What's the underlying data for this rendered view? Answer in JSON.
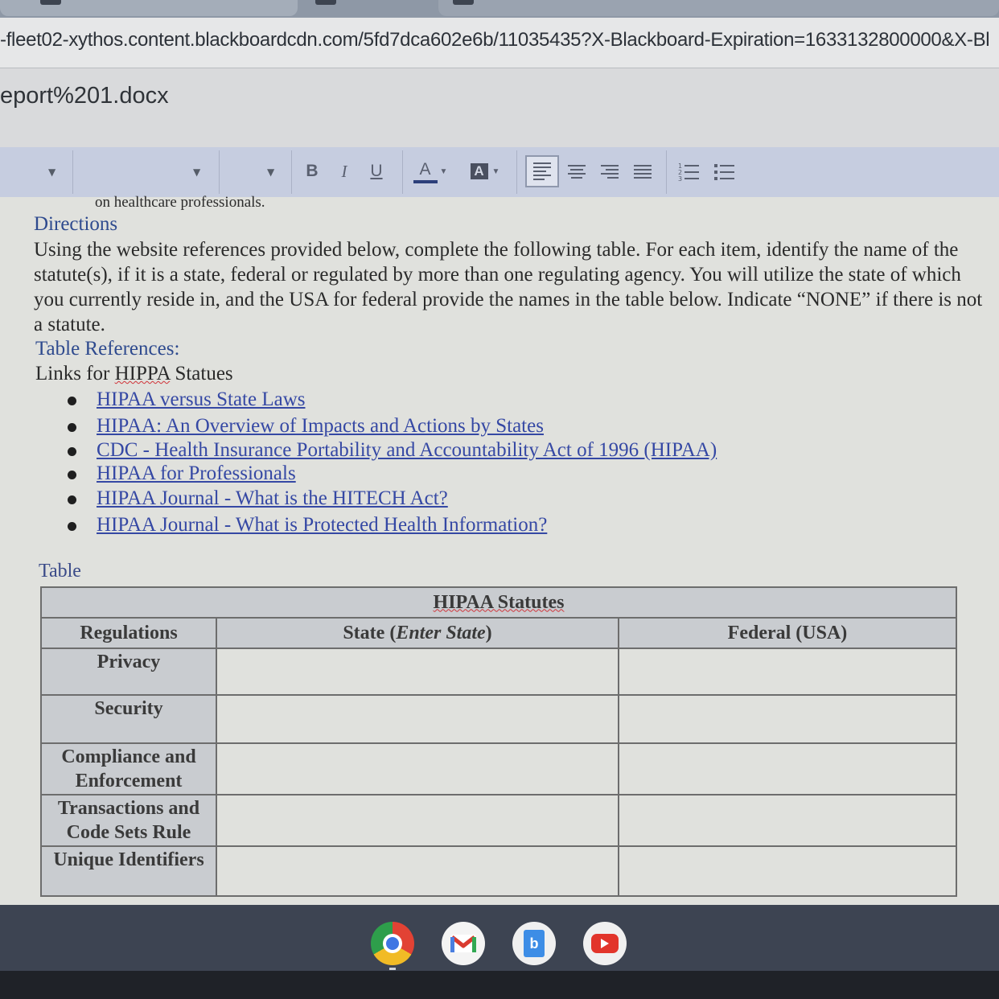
{
  "browser": {
    "url": "-fleet02-xythos.content.blackboardcdn.com/5fd7dca602e6b/11035435?X-Blackboard-Expiration=1633132800000&X-Bl"
  },
  "document": {
    "filename": "eport%201.docx"
  },
  "toolbar": {
    "bold": "B",
    "italic": "I",
    "underline": "U",
    "font_color": "A",
    "highlight": "A",
    "align_left_icon": "align-left-icon",
    "align_center_icon": "align-center-icon",
    "align_right_icon": "align-right-icon",
    "justify_icon": "justify-icon",
    "numbered_list_icon": "numbered-list-icon",
    "bulleted_list_icon": "bulleted-list-icon"
  },
  "content": {
    "cut_line": "on healthcare professionals.",
    "directions_heading": "Directions",
    "directions_text": "Using the website references provided below, complete the following table.  For each item, identify the name of the statute(s), if it is a state, federal or regulated by more than one regulating agency.  You will utilize the state of which you currently reside in, and the USA for federal provide the names in the table below. Indicate “NONE” if there is not a statute.",
    "references_heading": "Table References:",
    "links_intro_prefix": "Links for ",
    "links_intro_word": "HIPPA",
    "links_intro_suffix": " Statues",
    "links": [
      "HIPAA versus State Laws",
      "HIPAA: An Overview of Impacts and Actions by States",
      "CDC - Health Insurance Portability and Accountability Act of 1996 (HIPAA)",
      "HIPAA for Professionals",
      "HIPAA Journal - What is the HITECH Act?",
      "HIPAA Journal - What is Protected Health Information?"
    ],
    "table_caption": "Table"
  },
  "table": {
    "title": "HIPAA Statutes",
    "col_regulations": "Regulations",
    "col_state_prefix": "State (",
    "col_state_italic": "Enter State",
    "col_state_suffix": ")",
    "col_federal": "Federal (USA)",
    "rows": [
      {
        "line1": "Privacy",
        "line2": ""
      },
      {
        "line1": "Security",
        "line2": ""
      },
      {
        "line1": "Compliance and",
        "line2": "Enforcement"
      },
      {
        "line1": "Transactions and",
        "line2": "Code Sets Rule"
      },
      {
        "line1": "Unique Identifiers",
        "line2": ""
      }
    ]
  },
  "shelf": {
    "apps": [
      "chrome-icon",
      "gmail-icon",
      "docs-icon",
      "youtube-icon"
    ]
  }
}
